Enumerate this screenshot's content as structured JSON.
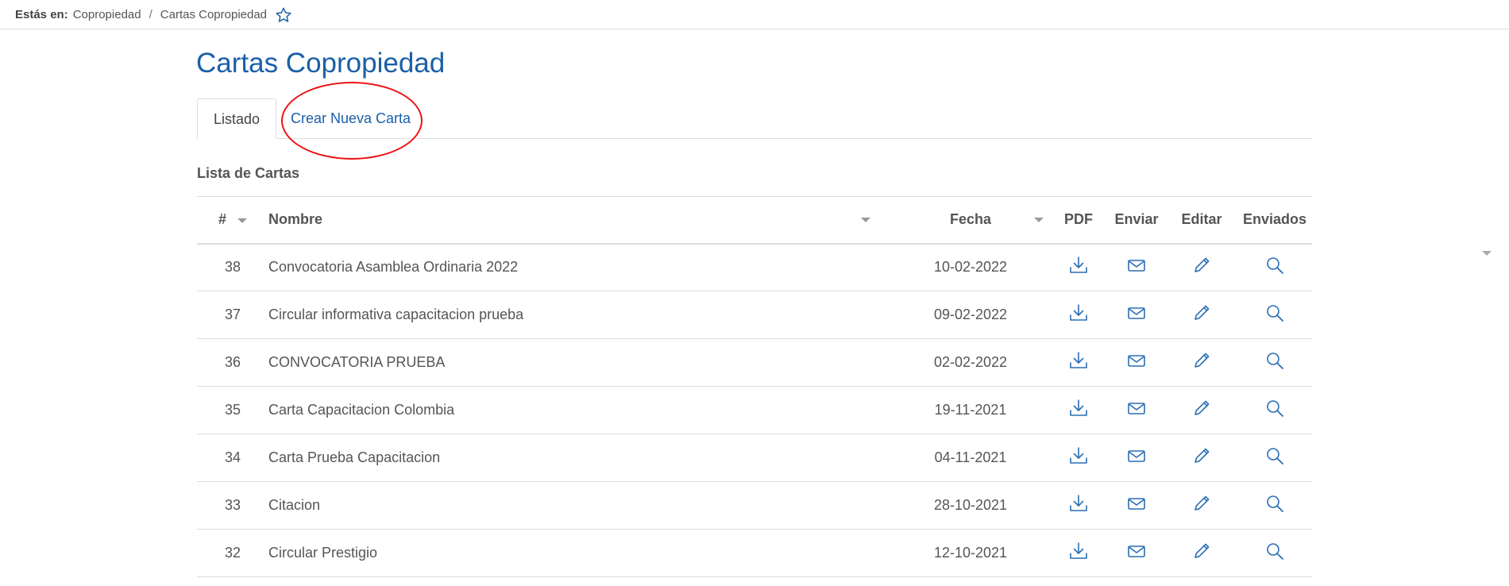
{
  "breadcrumb": {
    "label": "Estás en:",
    "items": [
      "Copropiedad",
      "Cartas Copropiedad"
    ],
    "separator": "/"
  },
  "page": {
    "title": "Cartas Copropiedad"
  },
  "tabs": [
    {
      "label": "Listado",
      "active": true
    },
    {
      "label": "Crear Nueva Carta",
      "active": false
    }
  ],
  "list": {
    "title": "Lista de Cartas",
    "columns": [
      "#",
      "Nombre",
      "Fecha",
      "PDF",
      "Enviar",
      "Editar",
      "Enviados"
    ],
    "rows": [
      {
        "num": "38",
        "nombre": "Convocatoria Asamblea Ordinaria 2022",
        "fecha": "10-02-2022"
      },
      {
        "num": "37",
        "nombre": "Circular informativa capacitacion prueba",
        "fecha": "09-02-2022"
      },
      {
        "num": "36",
        "nombre": "CONVOCATORIA PRUEBA",
        "fecha": "02-02-2022"
      },
      {
        "num": "35",
        "nombre": "Carta Capacitacion Colombia",
        "fecha": "19-11-2021"
      },
      {
        "num": "34",
        "nombre": "Carta Prueba Capacitacion",
        "fecha": "04-11-2021"
      },
      {
        "num": "33",
        "nombre": "Citacion",
        "fecha": "28-10-2021"
      },
      {
        "num": "32",
        "nombre": "Circular Prestigio",
        "fecha": "12-10-2021"
      }
    ]
  },
  "colors": {
    "accent": "#1a5fa8",
    "annotation": "#e11111"
  },
  "icons": [
    "star-icon",
    "download-icon",
    "mail-icon",
    "pencil-icon",
    "search-icon",
    "sort-caret-icon"
  ]
}
